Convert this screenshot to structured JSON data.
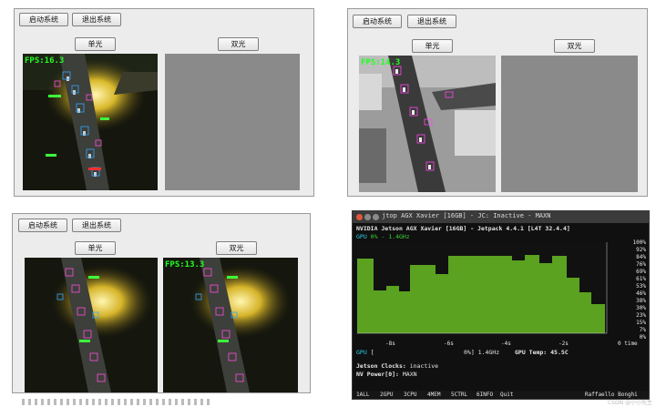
{
  "win1": {
    "start": "启动系统",
    "exit": "退出系统",
    "single": "单光",
    "dual": "双光",
    "fps": "FPS:16.3"
  },
  "win2": {
    "start": "启动系统",
    "exit": "退出系统",
    "single": "单光",
    "dual": "双光",
    "fps": "FPS:14.3"
  },
  "win3": {
    "start": "启动系统",
    "exit": "退出系统",
    "single": "单光",
    "dual": "双光",
    "fps_left": "FPS:13.2",
    "fps_right": "FPS:13.3"
  },
  "terminal": {
    "title": "jtop AGX Xavier [16GB] - JC: Inactive - MAXN",
    "header": "NVIDIA Jetson AGX Xavier [16GB] - Jetpack 4.4.1 [L4T 32.4.4]",
    "gpu_label": "GPU",
    "gpu_value": "0% - 1.4GHz",
    "y_ticks": [
      "100%",
      "92%",
      "84%",
      "76%",
      "69%",
      "61%",
      "53%",
      "46%",
      "38%",
      "30%",
      "23%",
      "15%",
      "7%",
      "0%"
    ],
    "x_ticks": [
      "-8s",
      "-6s",
      "-4s",
      "-2s",
      "0 time"
    ],
    "gpu_row_label": "GPU",
    "gpu_row_value": "0%] 1.4GHz",
    "gpu_temp": "GPU Temp: 45.5C",
    "clocks_label": "Jetson Clocks:",
    "clocks_value": "inactive",
    "nvp_label": "NV Power[0]:",
    "nvp_value": "MAXN",
    "fkeys": [
      "1ALL",
      "2GPU",
      "3CPU",
      "4MEM",
      "5CTRL",
      "6INFO",
      "Quit"
    ],
    "author": "Raffaello Bonghi",
    "chart_colors": {
      "fill": "#5aa21f",
      "bg": "#111111"
    }
  },
  "watermark": "CSDN @小小先生"
}
